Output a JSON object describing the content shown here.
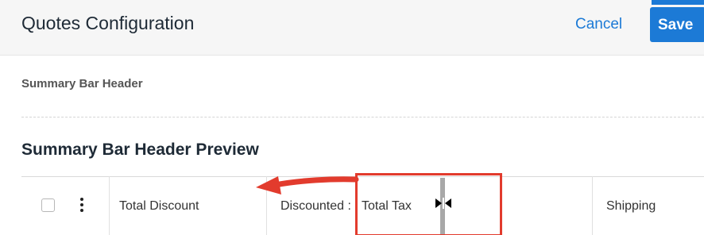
{
  "header": {
    "title": "Quotes Configuration",
    "cancel_label": "Cancel",
    "save_label": "Save"
  },
  "sections": {
    "summary_bar_header": "Summary Bar Header",
    "preview_title": "Summary Bar Header Preview"
  },
  "preview_table": {
    "columns": [
      "Total Discount",
      "Discounted :",
      "Total Tax",
      "Shipping"
    ]
  },
  "colors": {
    "accent_blue": "#1c7ad6",
    "annotation_red": "#e23b2d",
    "resizer_gray": "#a8a8a8"
  },
  "icons": {
    "kebab": "vertical-ellipsis-icon",
    "resize_cursor": "column-resize-cursor-icon",
    "annotation_arrow": "left-arrow-annotation-icon"
  }
}
